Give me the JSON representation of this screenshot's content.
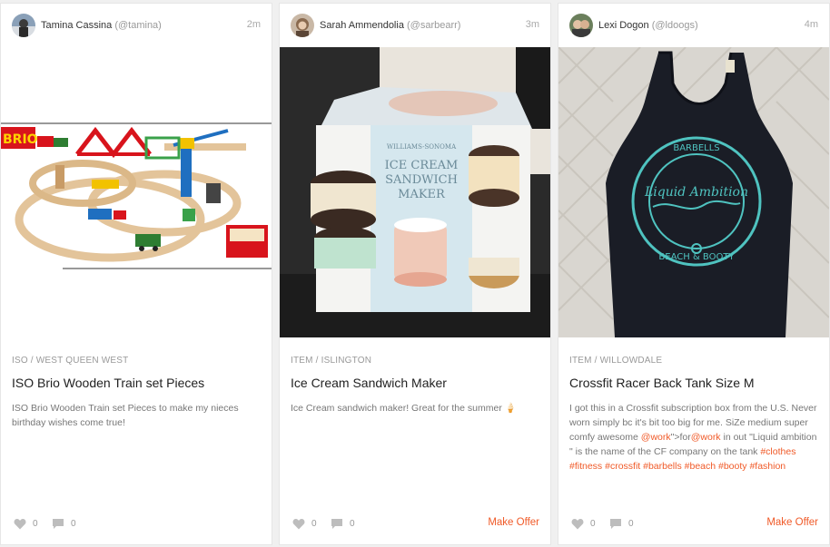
{
  "colors": {
    "accent": "#f05a28",
    "card_bg": "#ffffff",
    "page_bg": "#f0f0f0"
  },
  "cards": [
    {
      "author_name": "Tamina Cassina",
      "author_handle": "(@tamina)",
      "time": "2m",
      "image": "train-set-photo",
      "category": "ISO / WEST QUEEN WEST",
      "title": "ISO Brio Wooden Train set Pieces",
      "description": "ISO Brio Wooden Train set Pieces to make my nieces birthday wishes come true!",
      "likes": "0",
      "comments": "0",
      "make_offer": ""
    },
    {
      "author_name": "Sarah Ammendolia",
      "author_handle": "(@sarbearr)",
      "time": "3m",
      "image": "ice-cream-maker-photo",
      "box_brand": "WILLIAMS-SONOMA",
      "box_title": "ICE CREAM SANDWICH MAKER",
      "category": "ITEM / ISLINGTON",
      "title": "Ice Cream Sandwich Maker",
      "description": "Ice Cream sandwich maker! Great for the summer",
      "emoji": "🍦",
      "likes": "0",
      "comments": "0",
      "make_offer": "Make Offer"
    },
    {
      "author_name": "Lexi Dogon",
      "author_handle": "(@ldoogs)",
      "time": "4m",
      "image": "tank-top-photo",
      "shirt_text_top": "BARBELLS",
      "shirt_text_mid": "Liquid Ambition",
      "shirt_text_bottom": "BEACH & BOOTY",
      "category": "ITEM / WILLOWDALE",
      "title": "Crossfit Racer Back Tank Size M",
      "description_parts": {
        "p1": "I got this in a Crossfit subscription box from the U.S. Never worn simply bc it's bit too big for me. SiZe medium super comfy awesome ",
        "m1": "@work",
        "p2": "\">for",
        "m2": "@work",
        "p3": " in out \"Liquid ambition \" is the name of the CF company on the tank ",
        "tags": "#clothes #fitness #crossfit #barbells #beach #booty #fashion"
      },
      "likes": "0",
      "comments": "0",
      "make_offer": "Make Offer"
    }
  ]
}
